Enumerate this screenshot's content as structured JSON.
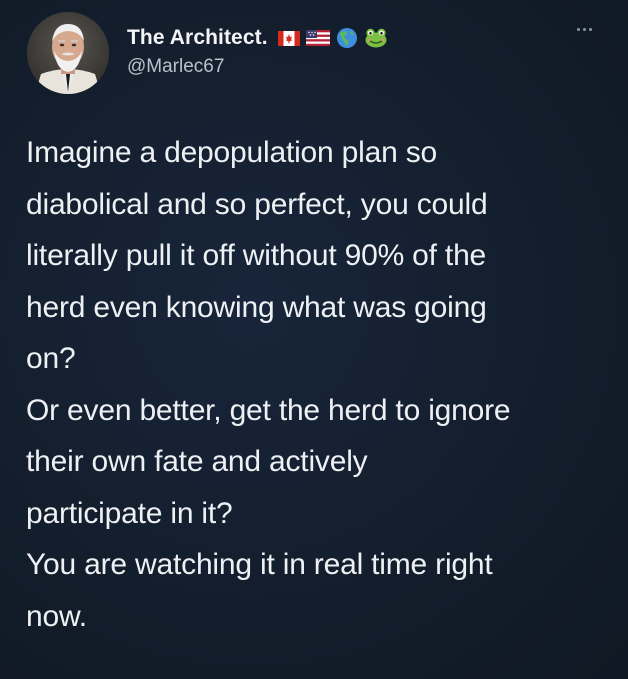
{
  "author": {
    "display_name": "The Architect.",
    "handle": "@Marlec67",
    "badges": [
      "flag-canada-icon",
      "flag-usa-icon",
      "globe-americas-icon",
      "frog-icon"
    ]
  },
  "tweet": {
    "lines": [
      "Imagine a depopulation plan so",
      "diabolical and so perfect, you could",
      "literally pull it off without 90% of the",
      "herd even knowing what was going",
      "on?",
      "Or even better, get the herd to ignore",
      "their own fate and actively",
      "participate in it?",
      "You are watching it in real time right",
      "now."
    ]
  },
  "colors": {
    "background": "#151f2c",
    "text": "#eef1f4",
    "handle": "#b8c2cc"
  }
}
